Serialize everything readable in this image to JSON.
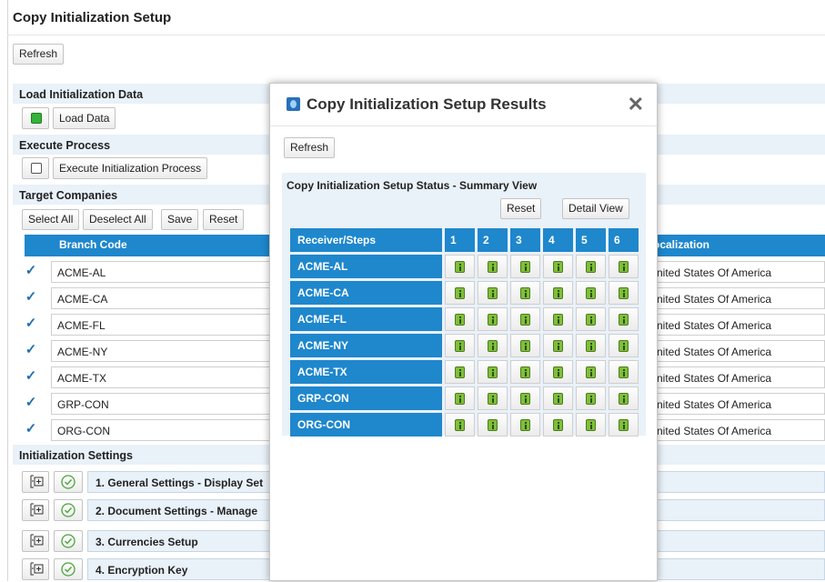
{
  "page": {
    "title": "Copy Initialization Setup",
    "refresh_label": "Refresh"
  },
  "load_section": {
    "title": "Load Initialization Data",
    "load_label": "Load Data"
  },
  "execute_section": {
    "title": "Execute Process",
    "execute_label": "Execute Initialization Process"
  },
  "target_section": {
    "title": "Target Companies",
    "toolbar": {
      "select_all": "Select All",
      "deselect_all": "Deselect All",
      "save": "Save",
      "reset": "Reset"
    },
    "columns": [
      "Branch Code",
      "ocalization"
    ],
    "rows": [
      {
        "code": "ACME-AL",
        "localization": "nited States Of America",
        "checked": true
      },
      {
        "code": "ACME-CA",
        "localization": "nited States Of America",
        "checked": true
      },
      {
        "code": "ACME-FL",
        "localization": "nited States Of America",
        "checked": true
      },
      {
        "code": "ACME-NY",
        "localization": "nited States Of America",
        "checked": true
      },
      {
        "code": "ACME-TX",
        "localization": "nited States Of America",
        "checked": true
      },
      {
        "code": "GRP-CON",
        "localization": "nited States Of America",
        "checked": true
      },
      {
        "code": "ORG-CON",
        "localization": "nited States Of America",
        "checked": true
      }
    ]
  },
  "settings_section": {
    "title": "Initialization Settings",
    "items": [
      {
        "label": "1. General Settings - Display Set"
      },
      {
        "label": "2. Document Settings - Manage"
      },
      {
        "label": "3. Currencies Setup"
      },
      {
        "label": "4. Encryption Key"
      }
    ]
  },
  "modal": {
    "title": "Copy Initialization Setup Results",
    "refresh_label": "Refresh",
    "panel_title": "Copy Initialization Setup Status - Summary View",
    "reset_label": "Reset",
    "detail_view_label": "Detail View",
    "receiver_header": "Receiver/Steps",
    "steps": [
      "1",
      "2",
      "3",
      "4",
      "5",
      "6"
    ],
    "receivers": [
      "ACME-AL",
      "ACME-CA",
      "ACME-FL",
      "ACME-NY",
      "ACME-TX",
      "GRP-CON",
      "ORG-CON"
    ]
  },
  "icons": {
    "check": "✓",
    "close": "✕",
    "expand": "expand-tree-icon",
    "done": "check-circle-icon",
    "info": "info-icon",
    "logo": "app-logo-icon"
  },
  "colors": {
    "header_blue": "#1f87cc",
    "section_bg": "#e9f1f9",
    "status_green": "#35b23a",
    "info_green": "#7fbf3a"
  }
}
